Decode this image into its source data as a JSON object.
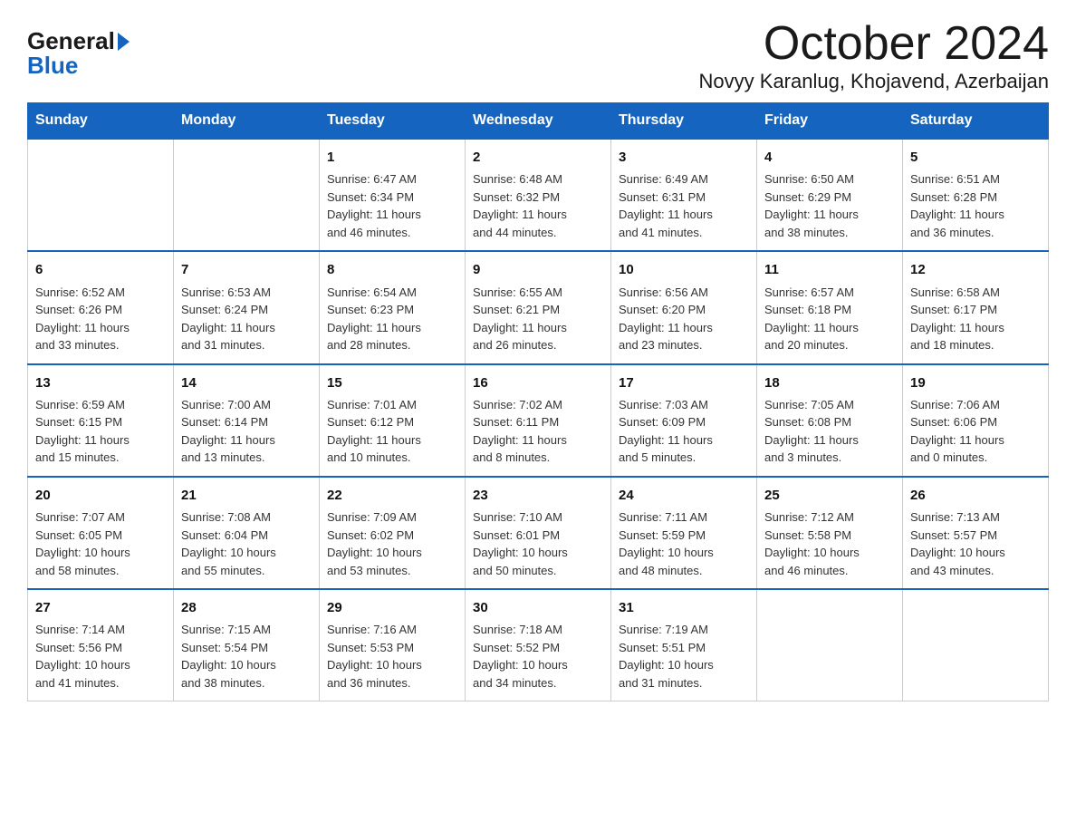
{
  "logo": {
    "general": "General",
    "blue": "Blue"
  },
  "header": {
    "month": "October 2024",
    "location": "Novyy Karanlug, Khojavend, Azerbaijan"
  },
  "columns": [
    "Sunday",
    "Monday",
    "Tuesday",
    "Wednesday",
    "Thursday",
    "Friday",
    "Saturday"
  ],
  "weeks": [
    [
      {
        "day": "",
        "info": ""
      },
      {
        "day": "",
        "info": ""
      },
      {
        "day": "1",
        "info": "Sunrise: 6:47 AM\nSunset: 6:34 PM\nDaylight: 11 hours\nand 46 minutes."
      },
      {
        "day": "2",
        "info": "Sunrise: 6:48 AM\nSunset: 6:32 PM\nDaylight: 11 hours\nand 44 minutes."
      },
      {
        "day": "3",
        "info": "Sunrise: 6:49 AM\nSunset: 6:31 PM\nDaylight: 11 hours\nand 41 minutes."
      },
      {
        "day": "4",
        "info": "Sunrise: 6:50 AM\nSunset: 6:29 PM\nDaylight: 11 hours\nand 38 minutes."
      },
      {
        "day": "5",
        "info": "Sunrise: 6:51 AM\nSunset: 6:28 PM\nDaylight: 11 hours\nand 36 minutes."
      }
    ],
    [
      {
        "day": "6",
        "info": "Sunrise: 6:52 AM\nSunset: 6:26 PM\nDaylight: 11 hours\nand 33 minutes."
      },
      {
        "day": "7",
        "info": "Sunrise: 6:53 AM\nSunset: 6:24 PM\nDaylight: 11 hours\nand 31 minutes."
      },
      {
        "day": "8",
        "info": "Sunrise: 6:54 AM\nSunset: 6:23 PM\nDaylight: 11 hours\nand 28 minutes."
      },
      {
        "day": "9",
        "info": "Sunrise: 6:55 AM\nSunset: 6:21 PM\nDaylight: 11 hours\nand 26 minutes."
      },
      {
        "day": "10",
        "info": "Sunrise: 6:56 AM\nSunset: 6:20 PM\nDaylight: 11 hours\nand 23 minutes."
      },
      {
        "day": "11",
        "info": "Sunrise: 6:57 AM\nSunset: 6:18 PM\nDaylight: 11 hours\nand 20 minutes."
      },
      {
        "day": "12",
        "info": "Sunrise: 6:58 AM\nSunset: 6:17 PM\nDaylight: 11 hours\nand 18 minutes."
      }
    ],
    [
      {
        "day": "13",
        "info": "Sunrise: 6:59 AM\nSunset: 6:15 PM\nDaylight: 11 hours\nand 15 minutes."
      },
      {
        "day": "14",
        "info": "Sunrise: 7:00 AM\nSunset: 6:14 PM\nDaylight: 11 hours\nand 13 minutes."
      },
      {
        "day": "15",
        "info": "Sunrise: 7:01 AM\nSunset: 6:12 PM\nDaylight: 11 hours\nand 10 minutes."
      },
      {
        "day": "16",
        "info": "Sunrise: 7:02 AM\nSunset: 6:11 PM\nDaylight: 11 hours\nand 8 minutes."
      },
      {
        "day": "17",
        "info": "Sunrise: 7:03 AM\nSunset: 6:09 PM\nDaylight: 11 hours\nand 5 minutes."
      },
      {
        "day": "18",
        "info": "Sunrise: 7:05 AM\nSunset: 6:08 PM\nDaylight: 11 hours\nand 3 minutes."
      },
      {
        "day": "19",
        "info": "Sunrise: 7:06 AM\nSunset: 6:06 PM\nDaylight: 11 hours\nand 0 minutes."
      }
    ],
    [
      {
        "day": "20",
        "info": "Sunrise: 7:07 AM\nSunset: 6:05 PM\nDaylight: 10 hours\nand 58 minutes."
      },
      {
        "day": "21",
        "info": "Sunrise: 7:08 AM\nSunset: 6:04 PM\nDaylight: 10 hours\nand 55 minutes."
      },
      {
        "day": "22",
        "info": "Sunrise: 7:09 AM\nSunset: 6:02 PM\nDaylight: 10 hours\nand 53 minutes."
      },
      {
        "day": "23",
        "info": "Sunrise: 7:10 AM\nSunset: 6:01 PM\nDaylight: 10 hours\nand 50 minutes."
      },
      {
        "day": "24",
        "info": "Sunrise: 7:11 AM\nSunset: 5:59 PM\nDaylight: 10 hours\nand 48 minutes."
      },
      {
        "day": "25",
        "info": "Sunrise: 7:12 AM\nSunset: 5:58 PM\nDaylight: 10 hours\nand 46 minutes."
      },
      {
        "day": "26",
        "info": "Sunrise: 7:13 AM\nSunset: 5:57 PM\nDaylight: 10 hours\nand 43 minutes."
      }
    ],
    [
      {
        "day": "27",
        "info": "Sunrise: 7:14 AM\nSunset: 5:56 PM\nDaylight: 10 hours\nand 41 minutes."
      },
      {
        "day": "28",
        "info": "Sunrise: 7:15 AM\nSunset: 5:54 PM\nDaylight: 10 hours\nand 38 minutes."
      },
      {
        "day": "29",
        "info": "Sunrise: 7:16 AM\nSunset: 5:53 PM\nDaylight: 10 hours\nand 36 minutes."
      },
      {
        "day": "30",
        "info": "Sunrise: 7:18 AM\nSunset: 5:52 PM\nDaylight: 10 hours\nand 34 minutes."
      },
      {
        "day": "31",
        "info": "Sunrise: 7:19 AM\nSunset: 5:51 PM\nDaylight: 10 hours\nand 31 minutes."
      },
      {
        "day": "",
        "info": ""
      },
      {
        "day": "",
        "info": ""
      }
    ]
  ]
}
